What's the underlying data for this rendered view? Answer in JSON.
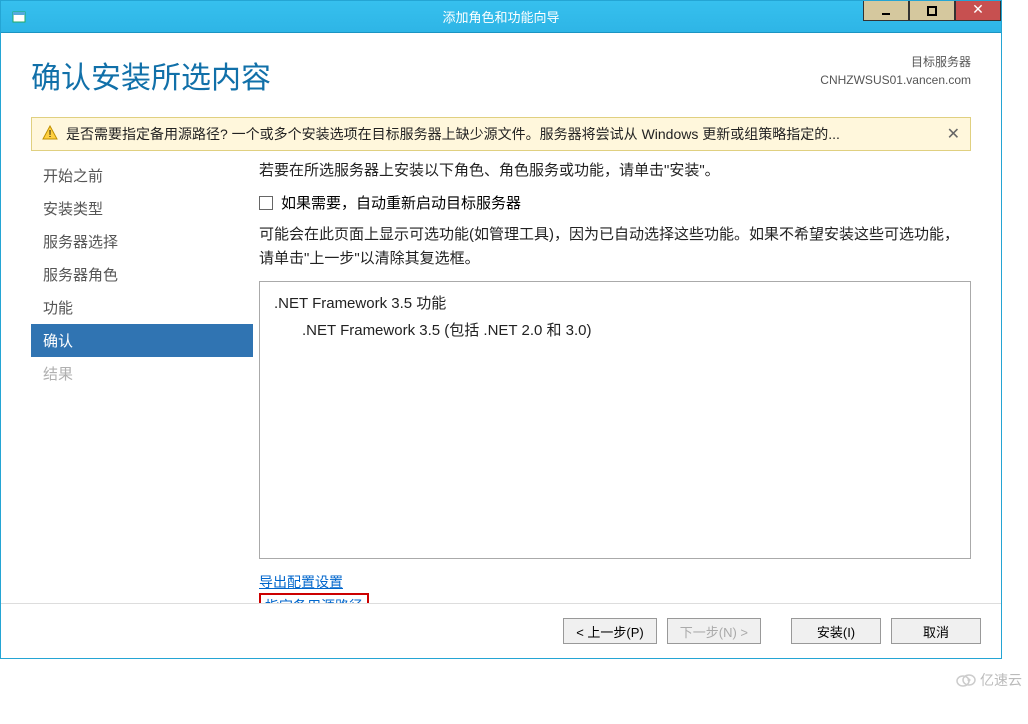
{
  "titlebar": {
    "text": "添加角色和功能向导"
  },
  "header": {
    "heading": "确认安装所选内容",
    "server_label": "目标服务器",
    "server_name": "CNHZWSUS01.vancen.com"
  },
  "warning": {
    "text": "是否需要指定备用源路径? 一个或多个安装选项在目标服务器上缺少源文件。服务器将尝试从 Windows 更新或组策略指定的..."
  },
  "sidebar": {
    "items": [
      {
        "label": "开始之前",
        "state": "normal"
      },
      {
        "label": "安装类型",
        "state": "normal"
      },
      {
        "label": "服务器选择",
        "state": "normal"
      },
      {
        "label": "服务器角色",
        "state": "normal"
      },
      {
        "label": "功能",
        "state": "normal"
      },
      {
        "label": "确认",
        "state": "active"
      },
      {
        "label": "结果",
        "state": "disabled"
      }
    ]
  },
  "main": {
    "intro": "若要在所选服务器上安装以下角色、角色服务或功能，请单击\"安装\"。",
    "auto_restart_label": "如果需要，自动重新启动目标服务器",
    "description": "可能会在此页面上显示可选功能(如管理工具)，因为已自动选择这些功能。如果不希望安装这些可选功能，请单击\"上一步\"以清除其复选框。",
    "features": {
      "parent": ".NET Framework 3.5 功能",
      "child": ".NET Framework 3.5 (包括 .NET 2.0 和 3.0)"
    },
    "links": {
      "export": "导出配置设置",
      "specify_source": "指定备用源路径"
    }
  },
  "footer": {
    "prev": "< 上一步(P)",
    "next": "下一步(N) >",
    "install": "安装(I)",
    "cancel": "取消"
  },
  "watermark": "亿速云"
}
